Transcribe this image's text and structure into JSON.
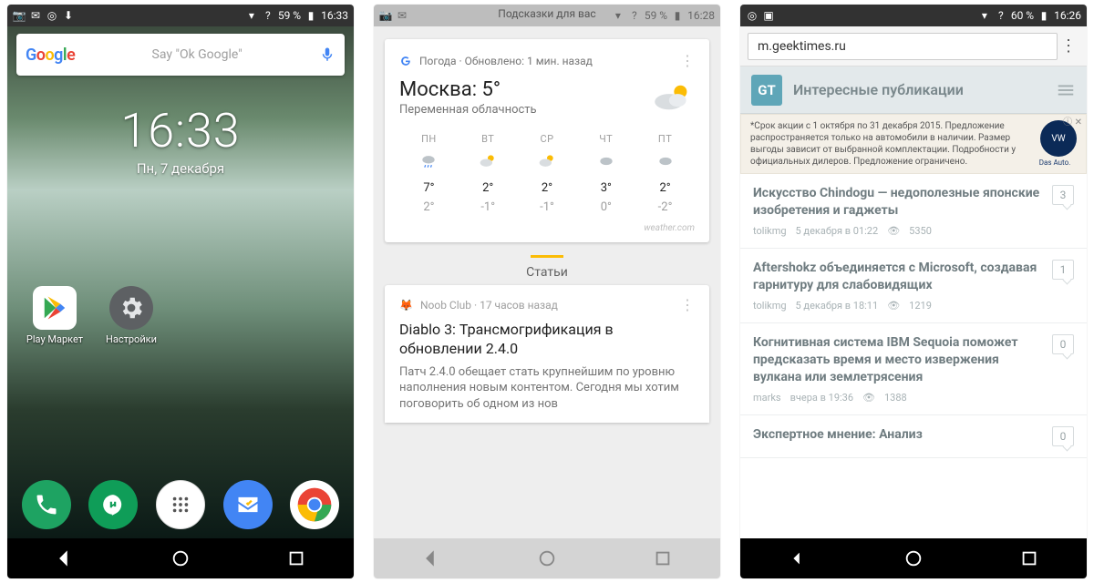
{
  "phone1": {
    "status": {
      "battery": "59 %",
      "time": "16:33"
    },
    "search": {
      "placeholder": "Say \"Ok Google\""
    },
    "clock": {
      "time": "16:33",
      "date": "Пн, 7 декабря"
    },
    "apps": [
      {
        "label": "Play Маркет"
      },
      {
        "label": "Настройки"
      }
    ]
  },
  "phone2": {
    "top_hint": "Подсказки для вас",
    "status": {
      "battery": "59 %",
      "time": "16:28"
    },
    "weather": {
      "head": "Погода · Обновлено: 1 мин. назад",
      "city_temp": "Москва: 5°",
      "cond": "Переменная облачность",
      "days": [
        {
          "d": "ПН",
          "hi": "7°",
          "lo": "2°"
        },
        {
          "d": "ВТ",
          "hi": "2°",
          "lo": "-1°"
        },
        {
          "d": "СР",
          "hi": "2°",
          "lo": "-1°"
        },
        {
          "d": "ЧТ",
          "hi": "3°",
          "lo": "0°"
        },
        {
          "d": "ПТ",
          "hi": "2°",
          "lo": "-2°"
        }
      ],
      "source": "weather.com"
    },
    "tab": "Статьи",
    "article": {
      "src": "Noob Club · 17 часов назад",
      "title": "Diablo 3: Трансмогрификация в обновлении 2.4.0",
      "summary": "Патч 2.4.0 обещает стать крупнейшим по уровню наполнения новым контентом. Сегодня мы хотим поговорить об одном из нов"
    }
  },
  "phone3": {
    "status": {
      "battery": "60 %",
      "time": "16:26"
    },
    "url": "m.geektimes.ru",
    "site_title": "Интересные публикации",
    "logo": "GT",
    "ad_text": "*Срок акции с 1 октября по 31 декабря 2015. Предложение распространяется только на автомобили в наличии. Размер выгоды зависит от выбранной комплектации. Подробности у официальных дилеров. Предложение ограничено.",
    "ad_brand": "Das Auto.",
    "posts": [
      {
        "title": "Искусство Chindogu — недополезные японские изобретения и гаджеты",
        "author": "tolikmg",
        "date": "5 декабря в 01:22",
        "views": "5350",
        "comments": "3"
      },
      {
        "title": "Aftershokz объединяется с Microsoft, создавая гарнитуру для слабовидящих",
        "author": "tolikmg",
        "date": "5 декабря в 18:11",
        "views": "1219",
        "comments": "1"
      },
      {
        "title": "Когнитивная система IBM Sequoia поможет предсказать время и место извержения вулкана или землетрясения",
        "author": "marks",
        "date": "вчера в 19:36",
        "views": "1388",
        "comments": "0"
      },
      {
        "title": "Экспертное мнение: Анализ",
        "author": "",
        "date": "",
        "views": "",
        "comments": "0"
      }
    ]
  }
}
